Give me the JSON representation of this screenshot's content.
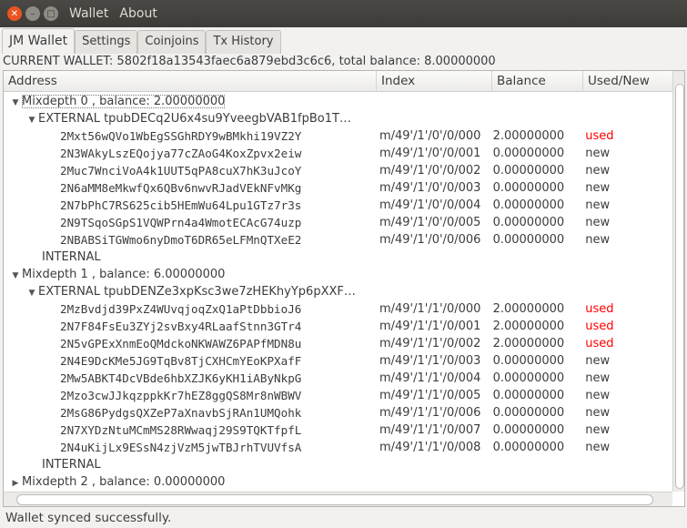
{
  "menu": [
    "Wallet",
    "About"
  ],
  "tabs": [
    "JM Wallet",
    "Settings",
    "Coinjoins",
    "Tx History"
  ],
  "wallet_info": "CURRENT WALLET: 5802f18a13543faec6a879ebd3c6c6, total balance: 8.00000000",
  "columns": [
    "Address",
    "Index",
    "Balance",
    "Used/New"
  ],
  "used_color": "#ff0000",
  "tree": [
    {
      "label": "Mixdepth 0 , balance: 2.00000000",
      "expanded": true,
      "children": [
        {
          "label": "EXTERNAL tpubDECq2U6x4su9YveegbVAB1fpBo1T…",
          "expanded": true,
          "addresses": [
            [
              "2Mxt56wQVo1WbEgSSGhRDY9wBMkhi19VZ2Y",
              "m/49'/1'/0'/0/000",
              "2.00000000",
              "used"
            ],
            [
              "2N3WAkyLszEQojya77cZAoG4KoxZpvx2eiw",
              "m/49'/1'/0'/0/001",
              "0.00000000",
              "new"
            ],
            [
              "2Muc7WnciVoA4k1UUT5qPA8cuX7hK3uJcoY",
              "m/49'/1'/0'/0/002",
              "0.00000000",
              "new"
            ],
            [
              "2N6aMM8eMkwfQx6QBv6nwvRJadVEkNFvMKg",
              "m/49'/1'/0'/0/003",
              "0.00000000",
              "new"
            ],
            [
              "2N7bPhC7RS625cib5HEmWu64Lpu1GTz7r3s",
              "m/49'/1'/0'/0/004",
              "0.00000000",
              "new"
            ],
            [
              "2N9TSqoSGpS1VQWPrn4a4WmotECAcG74uzp",
              "m/49'/1'/0'/0/005",
              "0.00000000",
              "new"
            ],
            [
              "2NBABSiTGWmo6nyDmoT6DR65eLFMnQTXeE2",
              "m/49'/1'/0'/0/006",
              "0.00000000",
              "new"
            ]
          ]
        },
        {
          "label": "INTERNAL",
          "expanded": false,
          "addresses": []
        }
      ]
    },
    {
      "label": "Mixdepth 1 , balance: 6.00000000",
      "expanded": true,
      "children": [
        {
          "label": "EXTERNAL tpubDENZe3xpKsc3we7zHEKhyYp6pXXF…",
          "expanded": true,
          "addresses": [
            [
              "2MzBvdjd39PxZ4WUvqjoqZxQ1aPtDbbioJ6",
              "m/49'/1'/1'/0/000",
              "2.00000000",
              "used"
            ],
            [
              "2N7F84FsEu3ZYj2svBxy4RLaafStnn3GTr4",
              "m/49'/1'/1'/0/001",
              "2.00000000",
              "used"
            ],
            [
              "2N5vGPExXnmEoQMdckoNKWAWZ6PAPfMDN8u",
              "m/49'/1'/1'/0/002",
              "2.00000000",
              "used"
            ],
            [
              "2N4E9DcKMe5JG9TqBv8TjCXHCmYEoKPXafF",
              "m/49'/1'/1'/0/003",
              "0.00000000",
              "new"
            ],
            [
              "2Mw5ABKT4DcVBde6hbXZJK6yKH1iAByNkpG",
              "m/49'/1'/1'/0/004",
              "0.00000000",
              "new"
            ],
            [
              "2Mzo3cwJJkqzppkKr7hEZ8ggQS8Mr8nWBWV",
              "m/49'/1'/1'/0/005",
              "0.00000000",
              "new"
            ],
            [
              "2MsG86PydgsQXZeP7aXnavbSjRAn1UMQohk",
              "m/49'/1'/1'/0/006",
              "0.00000000",
              "new"
            ],
            [
              "2N7XYDzNtuMCmMS28RWwaqj29S9TQKTfpfL",
              "m/49'/1'/1'/0/007",
              "0.00000000",
              "new"
            ],
            [
              "2N4uKijLx9ESsN4zjVzM5jwTBJrhTVUVfsA",
              "m/49'/1'/1'/0/008",
              "0.00000000",
              "new"
            ]
          ]
        },
        {
          "label": "INTERNAL",
          "expanded": false,
          "addresses": []
        }
      ]
    },
    {
      "label": "Mixdepth 2 , balance: 0.00000000",
      "expanded": false,
      "children": []
    }
  ],
  "status": "Wallet synced successfully."
}
